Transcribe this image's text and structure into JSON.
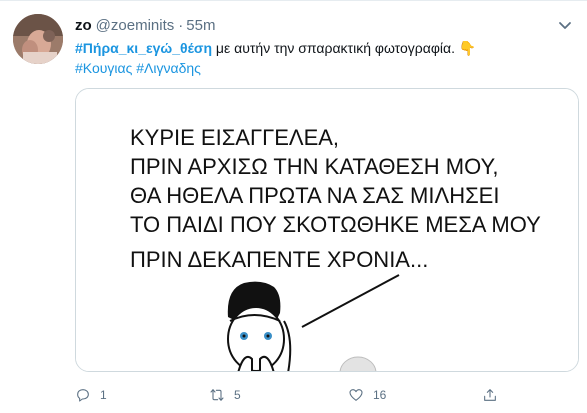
{
  "tweet": {
    "display_name": "zo",
    "handle": "@zoeminits",
    "separator": "·",
    "time": "55m",
    "text": {
      "hashtag1": "#Πήρα_κι_εγώ_θέση",
      "body": " με αυτήν την σπαρακτική φωτογραφία. ",
      "emoji": "👇",
      "hashtag2": "#Κουγιας",
      "hashtag3": "#Λιγναδης"
    },
    "media": {
      "caption_lines": [
        "ΚΥΡΙΕ ΕΙΣΑΓΓΕΛΕΑ,",
        "ΠΡΙΝ ΑΡΧΙΣΩ ΤΗΝ ΚΑΤΑΘΕΣΗ ΜΟΥ,",
        "ΘΑ ΗΘΕΛΑ ΠΡΩΤΑ ΝΑ ΣΑΣ ΜΙΛΗΣΕΙ",
        "ΤΟ ΠΑΙΔΙ ΠΟΥ ΣΚΟΤΩΘΗΚΕ ΜΕΣΑ ΜΟΥ",
        "ΠΡΙΝ ΔΕΚΑΠΕΝΤΕ ΧΡΟΝΙΑ..."
      ]
    },
    "actions": {
      "reply_count": "1",
      "retweet_count": "5",
      "like_count": "16",
      "share_count": ""
    },
    "colors": {
      "accent": "#1b95e0",
      "muted": "#5b7083",
      "border": "#cfd9de"
    }
  }
}
